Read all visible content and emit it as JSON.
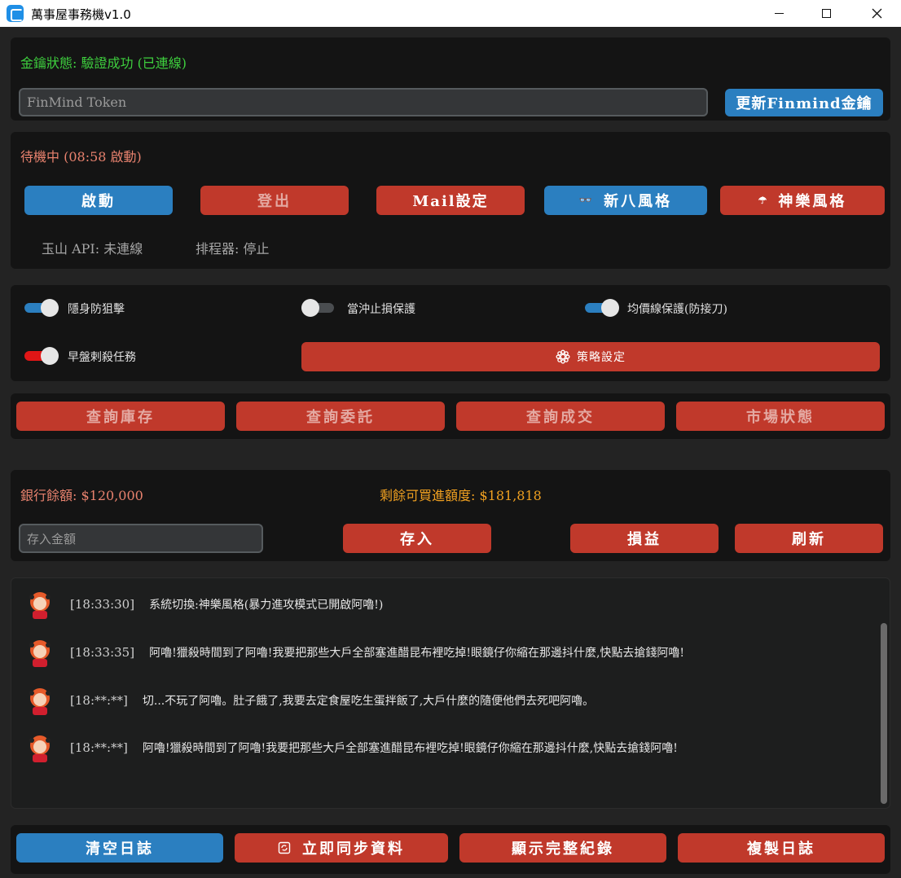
{
  "window": {
    "title": "萬事屋事務機v1.0"
  },
  "token_panel": {
    "status": "金鑰狀態: 驗證成功 (已連線)",
    "token_placeholder": "FinMind Token",
    "update_button": "更新Finmind金鑰"
  },
  "control_panel": {
    "standby_status": "待機中 (08:58 啟動)",
    "buttons": {
      "start": "啟動",
      "logout": "登出",
      "mail": "Mail設定",
      "style_shinpachi": "新八風格",
      "style_kagura": "神樂風格"
    },
    "api_status": "玉山 API: 未連線",
    "scheduler_status": "排程器: 停止"
  },
  "options": {
    "stealth_snipe": {
      "label": "隱身防狙擊",
      "on": true
    },
    "daytrade_stoploss": {
      "label": "當沖止損保護",
      "on": false
    },
    "ma_protect": {
      "label": "均價線保護(防接刀)",
      "on": true
    },
    "morning_kill": {
      "label": "早盤剌殺任務",
      "on": true
    },
    "strategy_button": "策略設定"
  },
  "query": {
    "inventory": "查詢庫存",
    "orders": "查詢委託",
    "deals": "查詢成交",
    "market": "市場狀態"
  },
  "bank": {
    "balance": "銀行餘額: $120,000",
    "buying_power": "剩餘可買進額度: $181,818",
    "deposit_placeholder": "存入金額",
    "deposit_button": "存入",
    "pnl_button": "損益",
    "refresh_button": "刷新"
  },
  "log": [
    {
      "time": "[18:33:30]",
      "msg": "系統切換:神樂風格(暴力進攻模式已開啟阿嚕!)"
    },
    {
      "time": "[18:33:35]",
      "msg": "阿嚕!獵殺時間到了阿嚕!我要把那些大戶全部塞進醋昆布裡吃掉!眼鏡仔你縮在那邊抖什麼,快點去搶錢阿嚕!"
    },
    {
      "time": "[18:**:**]",
      "msg": "切...不玩了阿嚕。肚子餓了,我要去定食屋吃生蛋拌飯了,大戶什麼的隨便他們去死吧阿嚕。"
    },
    {
      "time": "[18:**:**]",
      "msg": "阿嚕!獵殺時間到了阿嚕!我要把那些大戶全部塞進醋昆布裡吃掉!眼鏡仔你縮在那邊抖什麼,快點去搶錢阿嚕!"
    }
  ],
  "bottom": {
    "clear_log": "清空日誌",
    "sync_now": "立即同步資料",
    "show_full": "顯示完整紀錄",
    "copy_log": "複製日誌"
  },
  "colors": {
    "accent_blue": "#2b7fc0",
    "accent_red": "#c0392b",
    "status_green": "#3ecf3e",
    "warn_salmon": "#e8826e",
    "highlight_orange": "#f0a020",
    "panel_bg": "#141414"
  }
}
